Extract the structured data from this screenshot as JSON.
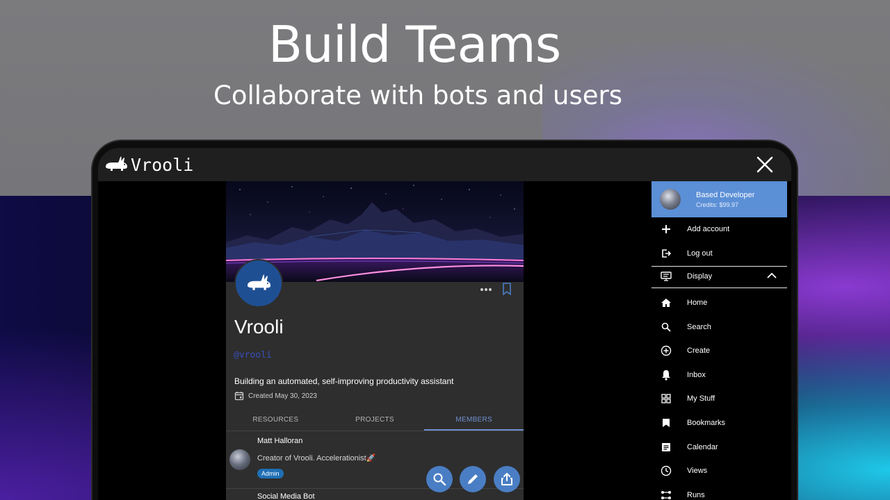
{
  "hero": {
    "title": "Build Teams",
    "subtitle": "Collaborate with bots and users"
  },
  "app": {
    "brand": "Vrooli"
  },
  "profile": {
    "name": "Vrooli",
    "handle": "@vrooli",
    "bio": "Building an automated, self-improving productivity assistant",
    "created": "Created May 30, 2023",
    "tabs": [
      "RESOURCES",
      "PROJECTS",
      "MEMBERS"
    ],
    "active_tab": "MEMBERS",
    "members": [
      {
        "name": "Matt Halloran",
        "description": "Creator of Vrooli. Accelerationist🚀",
        "badge": "Admin"
      },
      {
        "name": "Social Media Bot"
      }
    ]
  },
  "menu": {
    "account": {
      "name": "Based Developer",
      "credits": "Credits: $99.97"
    },
    "add_account": "Add account",
    "log_out": "Log out",
    "display": "Display",
    "items": [
      {
        "label": "Home",
        "icon": "home-icon"
      },
      {
        "label": "Search",
        "icon": "search-icon"
      },
      {
        "label": "Create",
        "icon": "create-icon"
      },
      {
        "label": "Inbox",
        "icon": "inbox-icon"
      },
      {
        "label": "My Stuff",
        "icon": "grid-icon"
      },
      {
        "label": "Bookmarks",
        "icon": "bookmark-icon"
      },
      {
        "label": "Calendar",
        "icon": "calendar-icon"
      },
      {
        "label": "Views",
        "icon": "clock-icon"
      },
      {
        "label": "Runs",
        "icon": "runs-icon"
      }
    ]
  },
  "colors": {
    "accent": "#5b8fd6",
    "fab": "#4a7ec4",
    "badge": "#1f6fb5",
    "panel": "#2e2e2e"
  }
}
